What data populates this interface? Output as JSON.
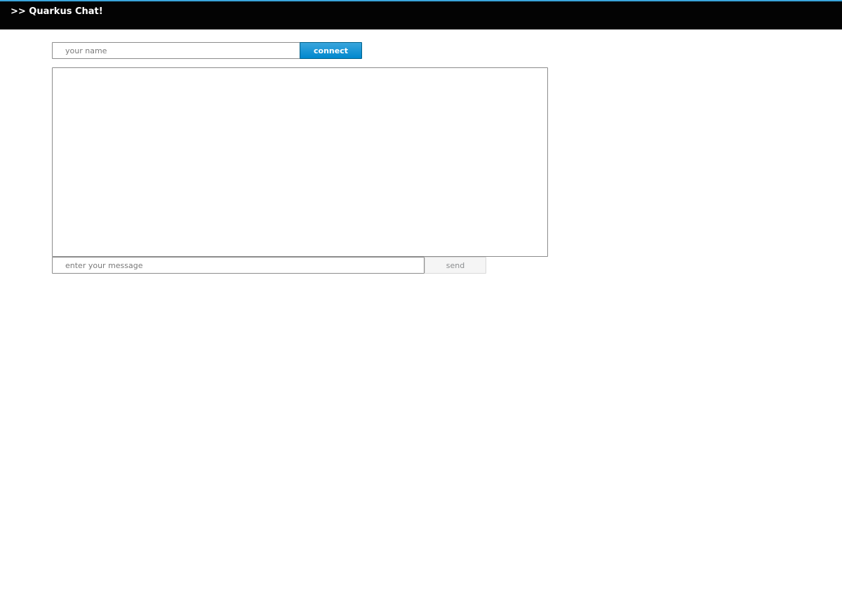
{
  "header": {
    "title": ">> Quarkus Chat!",
    "background_color": "#030303",
    "accent_color": "#39a5dc"
  },
  "connect_form": {
    "name_input": {
      "value": "",
      "placeholder": "your name"
    },
    "connect_button": {
      "label": "connect",
      "color": "#0088ce"
    }
  },
  "chat": {
    "messages_text": ""
  },
  "message_form": {
    "message_input": {
      "value": "",
      "placeholder": "enter your message"
    },
    "send_button": {
      "label": "send",
      "disabled": true
    }
  }
}
